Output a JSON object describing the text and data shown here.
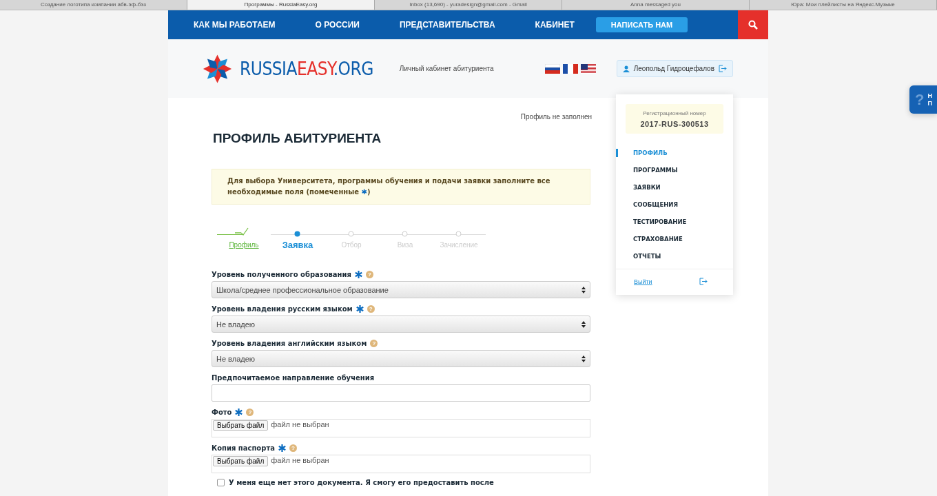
{
  "browser_tabs": [
    {
      "title": "Создание логотипа компании абв-эф-бэз",
      "selected": false
    },
    {
      "title": "Программы - RussiaEasy.org",
      "selected": true
    },
    {
      "title": "Inbox (13,690) - yuradesign@gmail.com - Gmail",
      "selected": false
    },
    {
      "title": "Anna messaged you",
      "selected": false
    },
    {
      "title": "Юра: Мои плейлисты на Яндекс.Музыке",
      "selected": false
    }
  ],
  "nav": {
    "items": [
      "КАК МЫ РАБОТАЕМ",
      "О РОССИИ",
      "ПРЕДСТАВИТЕЛЬСТВА",
      "КАБИНЕТ"
    ],
    "cta": "НАПИСАТЬ НАМ"
  },
  "header": {
    "logo_parts": [
      "RUSSIA",
      "EASY",
      ".ORG"
    ],
    "subtitle": "Личный кабинет абитуриента",
    "user_name": "Леопольд Гидроцефалов"
  },
  "user_menu": {
    "reg_label": "Регистрационный номер",
    "reg_number": "2017-RUS-300513",
    "items": [
      {
        "label": "ПРОФИЛЬ",
        "selected": true
      },
      {
        "label": "ПРОГРАММЫ",
        "selected": false
      },
      {
        "label": "ЗАЯВКИ",
        "selected": false
      },
      {
        "label": "СООБЩЕНИЯ",
        "selected": false
      },
      {
        "label": "ТЕСТИРОВАНИЕ",
        "selected": false
      },
      {
        "label": "СТРАХОВАНИЕ",
        "selected": false
      },
      {
        "label": "ОТЧЕТЫ",
        "selected": false
      }
    ],
    "logout": "Выйти"
  },
  "profile": {
    "status": "Профиль не заполнен",
    "title": "ПРОФИЛЬ АБИТУРИЕНТА",
    "notice_before": "Для выбора Университета, программы обучения и подачи заявки заполните все необходимые поля (помеченные ",
    "notice_mark": "✱",
    "notice_after": ")",
    "steps": [
      {
        "label": "Профиль",
        "done": true,
        "current": false
      },
      {
        "label": "Заявка",
        "done": false,
        "current": true
      },
      {
        "label": "Отбор",
        "done": false,
        "current": false
      },
      {
        "label": "Виза",
        "done": false,
        "current": false
      },
      {
        "label": "Зачисление",
        "done": false,
        "current": false
      }
    ],
    "fields": [
      {
        "kind": "select",
        "label": "Уровень полученного образования",
        "required": true,
        "help": "?",
        "value": "Школа/среднее профессиональное образование"
      },
      {
        "kind": "select",
        "label": "Уровень владения русским языком",
        "required": true,
        "help": "?",
        "value": "Не владею"
      },
      {
        "kind": "select",
        "label": "Уровень владения английским языком",
        "required": false,
        "help": "?",
        "value": "Не владею"
      },
      {
        "kind": "text",
        "label": "Предпочитаемое направление обучения",
        "required": false
      },
      {
        "kind": "file",
        "label": "Фото",
        "required": true,
        "help": "?",
        "button": "Выбрать файл",
        "status": "файл не выбран"
      },
      {
        "kind": "file",
        "label": "Копия паспорта",
        "required": true,
        "help": "?",
        "button": "Выбрать файл",
        "status": "файл не выбран"
      }
    ],
    "checkbox": {
      "label": "У меня еще нет этого документа. Я смогу его предоставить после",
      "checked": false
    }
  },
  "help_tab": {
    "icon": "?",
    "lines": [
      "Н",
      "П"
    ]
  }
}
